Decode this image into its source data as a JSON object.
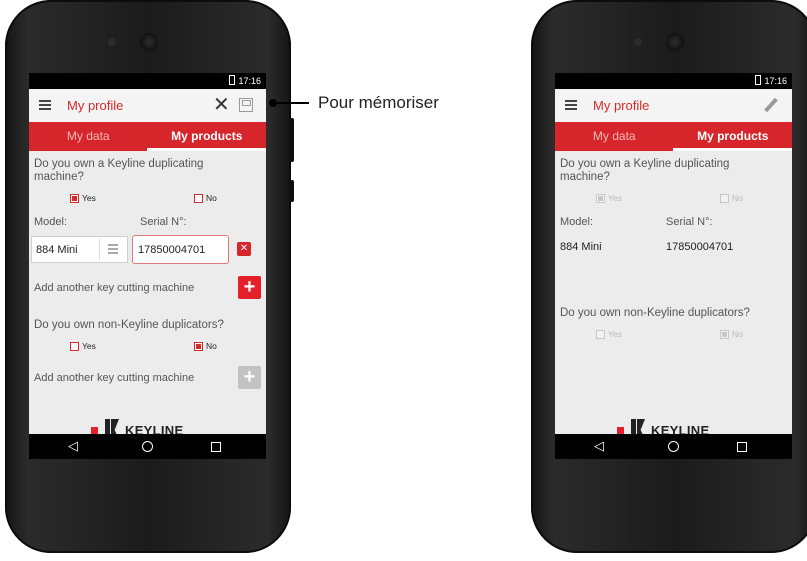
{
  "status_time": "17:16",
  "annotation": {
    "text": "Pour mémoriser"
  },
  "left_phone": {
    "title": "My profile",
    "tabs": [
      "My data",
      "My products"
    ],
    "question1": "Do you own a Keyline duplicating machine?",
    "yes": "Yes",
    "no": "No",
    "model_label": "Model:",
    "serial_label": "Serial N°:",
    "model_value": "884 Mini",
    "serial_value": "17850004701",
    "add_label": "Add another key cutting machine",
    "question2": "Do you own non-Keyline duplicators?",
    "add_label2": "Add another key cutting machine",
    "logo": "KEYLINE"
  },
  "right_phone": {
    "title": "My profile",
    "tabs": [
      "My data",
      "My products"
    ],
    "question1": "Do you own a Keyline duplicating machine?",
    "yes": "Yes",
    "no": "No",
    "model_label": "Model:",
    "serial_label": "Serial N°:",
    "model_value": "884 Mini",
    "serial_value": "17850004701",
    "question2": "Do you own non-Keyline duplicators?",
    "logo": "KEYLINE"
  },
  "icons": [
    "menu-icon",
    "close-icon",
    "save-icon",
    "pencil-icon",
    "list-icon",
    "delete-icon",
    "plus-icon",
    "back-icon",
    "home-icon",
    "recent-apps-icon"
  ],
  "colors": {
    "accent": "#d7262b",
    "screen_bg": "#ececec"
  }
}
